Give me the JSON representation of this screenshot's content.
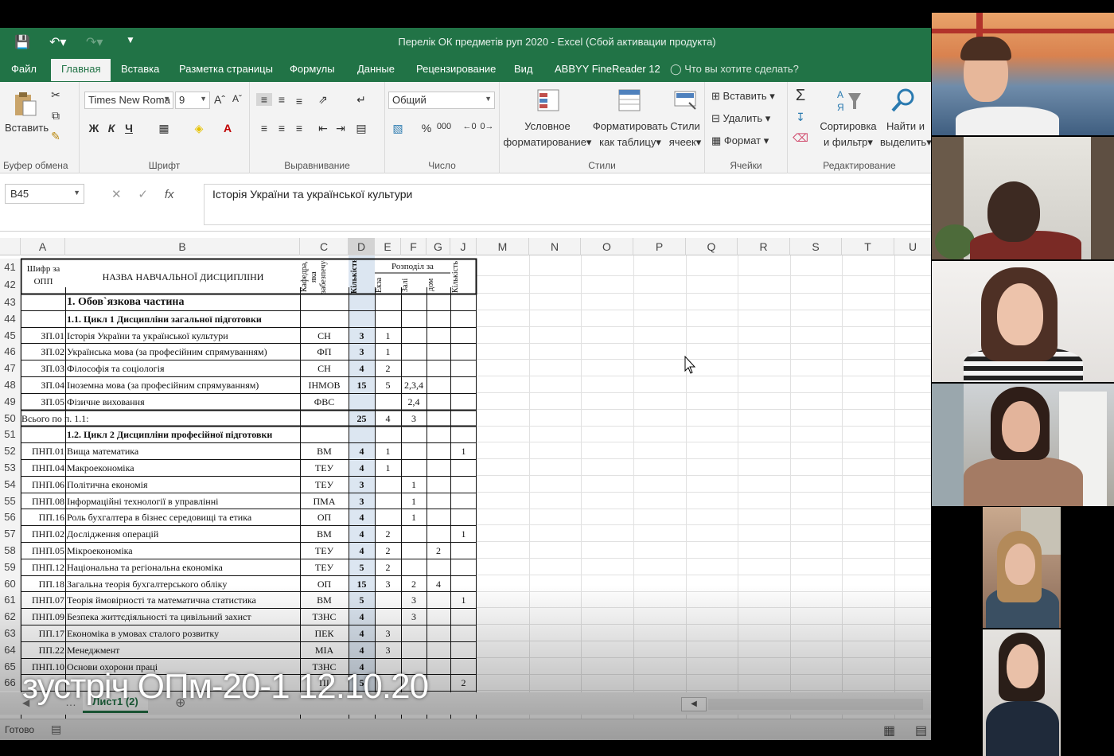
{
  "window": {
    "title": "Перелік ОК предметів руп 2020 - Excel (Сбой активации продукта)"
  },
  "tabs": [
    "Файл",
    "Главная",
    "Вставка",
    "Разметка страницы",
    "Формулы",
    "Данные",
    "Рецензирование",
    "Вид",
    "ABBYY FineReader 12"
  ],
  "active_tab": "Главная",
  "tellme": "Что вы хотите сделать?",
  "ribbon": {
    "clipboard": {
      "paste": "Вставить",
      "label": "Буфер обмена"
    },
    "font": {
      "name": "Times New Roma",
      "size": "9",
      "bold": "Ж",
      "italic": "К",
      "underline": "Ч",
      "label": "Шрифт"
    },
    "alignment": {
      "label": "Выравнивание"
    },
    "number": {
      "format": "Общий",
      "percent": "%",
      "thousands": "000",
      "label": "Число"
    },
    "styles": {
      "conditional_1": "Условное",
      "conditional_2": "форматирование",
      "table_1": "Форматировать",
      "table_2": "как таблицу",
      "cell_1": "Стили",
      "cell_2": "ячеек",
      "label": "Стили"
    },
    "cells": {
      "insert": "Вставить",
      "delete": "Удалить",
      "format": "Формат",
      "label": "Ячейки"
    },
    "editing": {
      "sort_1": "Сортировка",
      "sort_2": "и фильтр",
      "find_1": "Найти и",
      "find_2": "выделить",
      "label": "Редактирование"
    }
  },
  "formula_bar": {
    "name_box": "B45",
    "fx": "fx",
    "content": "Історія України та української культури"
  },
  "columns": [
    "A",
    "B",
    "C",
    "D",
    "E",
    "F",
    "G",
    "J",
    "M",
    "N",
    "O",
    "P",
    "Q",
    "R",
    "S",
    "T",
    "U"
  ],
  "header": {
    "a": "Шифр за ОПП",
    "b": "НАЗВА НАВЧАЛЬНОЇ ДИСЦИПЛІНИ",
    "c": "Кафедра, яка забезпечує",
    "d": "Кількість",
    "e_g": "Розподіл за",
    "e": "Екза",
    "f": "Залі",
    "g": "дом",
    "j": "Кількість"
  },
  "rows": [
    {
      "num": "43",
      "a": "",
      "b": "1. Обов`язкова частина",
      "c": "",
      "d": "",
      "e": "",
      "f": "",
      "g": "",
      "j": ""
    },
    {
      "num": "44",
      "a": "",
      "b": "1.1. Цикл 1 Дисципліни загальної підготовки",
      "c": "",
      "d": "",
      "e": "",
      "f": "",
      "g": "",
      "j": ""
    },
    {
      "num": "45",
      "a": "ЗП.01",
      "b": "Історія України та української культури",
      "c": "СН",
      "d": "3",
      "e": "1",
      "f": "",
      "g": "",
      "j": ""
    },
    {
      "num": "46",
      "a": "ЗП.02",
      "b": "Українська мова (за професійним спрямуванням)",
      "c": "ФП",
      "d": "3",
      "e": "1",
      "f": "",
      "g": "",
      "j": ""
    },
    {
      "num": "47",
      "a": "ЗП.03",
      "b": "Філософія та соціологія",
      "c": "СН",
      "d": "4",
      "e": "2",
      "f": "",
      "g": "",
      "j": ""
    },
    {
      "num": "48",
      "a": "ЗП.04",
      "b": "Іноземна мова (за професійним спрямуванням)",
      "c": "ІНМОВ",
      "d": "15",
      "e": "5",
      "f": "2,3,4",
      "g": "",
      "j": ""
    },
    {
      "num": "49",
      "a": "ЗП.05",
      "b": "Фізичне виховання",
      "c": "ФВС",
      "d": "",
      "e": "",
      "f": "2,4",
      "g": "",
      "j": ""
    },
    {
      "num": "50",
      "a": "Всього по п. 1.1:",
      "b": "",
      "c": "",
      "d": "25",
      "e": "4",
      "f": "3",
      "g": "",
      "j": ""
    },
    {
      "num": "51",
      "a": "",
      "b": "1.2. Цикл 2 Дисципліни професійної підготовки",
      "c": "",
      "d": "",
      "e": "",
      "f": "",
      "g": "",
      "j": ""
    },
    {
      "num": "52",
      "a": "ПНП.01",
      "b": "Вища математика",
      "c": "ВМ",
      "d": "4",
      "e": "1",
      "f": "",
      "g": "",
      "j": "1"
    },
    {
      "num": "53",
      "a": "ПНП.04",
      "b": "Макроекономіка",
      "c": "ТЕУ",
      "d": "4",
      "e": "1",
      "f": "",
      "g": "",
      "j": ""
    },
    {
      "num": "54",
      "a": "ПНП.06",
      "b": "Політична економія",
      "c": "ТЕУ",
      "d": "3",
      "e": "",
      "f": "1",
      "g": "",
      "j": ""
    },
    {
      "num": "55",
      "a": "ПНП.08",
      "b": "Інформаційні технології в управлінні",
      "c": "ПМА",
      "d": "3",
      "e": "",
      "f": "1",
      "g": "",
      "j": ""
    },
    {
      "num": "56",
      "a": "ПП.16",
      "b": "Роль бухгалтера в бізнес середовищі та етика",
      "c": "ОП",
      "d": "4",
      "e": "",
      "f": "1",
      "g": "",
      "j": ""
    },
    {
      "num": "57",
      "a": "ПНП.02",
      "b": "Дослідження операцій",
      "c": "ВМ",
      "d": "4",
      "e": "2",
      "f": "",
      "g": "",
      "j": "1"
    },
    {
      "num": "58",
      "a": "ПНП.05",
      "b": "Мікроекономіка",
      "c": "ТЕУ",
      "d": "4",
      "e": "2",
      "f": "",
      "g": "2",
      "j": ""
    },
    {
      "num": "59",
      "a": "ПНП.12",
      "b": "Національна та регіональна економіка",
      "c": "ТЕУ",
      "d": "5",
      "e": "2",
      "f": "",
      "g": "",
      "j": ""
    },
    {
      "num": "60",
      "a": "ПП.18",
      "b": "Загальна теорія бухгалтерського обліку",
      "c": "ОП",
      "d": "15",
      "e": "3",
      "f": "2",
      "g": "4",
      "j": ""
    },
    {
      "num": "61",
      "a": "ПНП.07",
      "b": "Теорія ймовірності та математична статистика",
      "c": "ВМ",
      "d": "5",
      "e": "",
      "f": "3",
      "g": "",
      "j": "1"
    },
    {
      "num": "62",
      "a": "ПНП.09",
      "b": "Безпека життєдіяльності та цивільний захист",
      "c": "ТЗНС",
      "d": "4",
      "e": "",
      "f": "3",
      "g": "",
      "j": ""
    },
    {
      "num": "63",
      "a": "ПП.17",
      "b": "Економіка в умовах сталого розвитку",
      "c": "ПЕК",
      "d": "4",
      "e": "3",
      "f": "",
      "g": "",
      "j": ""
    },
    {
      "num": "64",
      "a": "ПП.22",
      "b": "Менеджмент",
      "c": "МІА",
      "d": "4",
      "e": "3",
      "f": "",
      "g": "",
      "j": ""
    },
    {
      "num": "65",
      "a": "ПНП.10",
      "b": "Основи охорони праці",
      "c": "ТЗНС",
      "d": "4",
      "e": "",
      "f": "",
      "g": "",
      "j": ""
    },
    {
      "num": "66",
      "a": "",
      "b": "",
      "c": "ПІ",
      "d": "5",
      "e": "",
      "f": "",
      "g": "",
      "j": "2"
    }
  ],
  "sheet_tab": "Лист1 (2)",
  "status": "Готово",
  "caption": "зустріч ОПм-20-1 12.10.20",
  "colors": {
    "excel_green": "#217346",
    "ribbon_bg": "#f3f3f3",
    "selected_col": "#dce6f1"
  },
  "participants": [
    "participant-1",
    "participant-2",
    "participant-3",
    "participant-4",
    "participant-5",
    "participant-6"
  ]
}
